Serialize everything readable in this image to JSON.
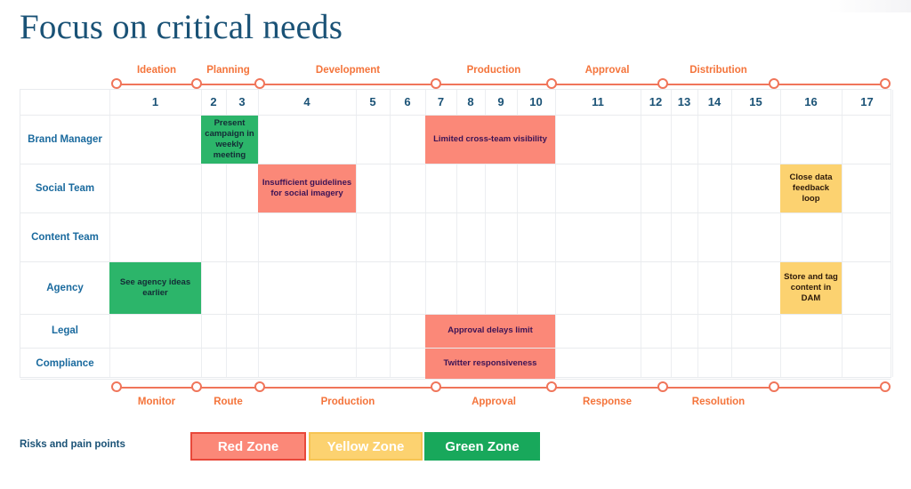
{
  "title": "Focus on critical needs",
  "colors": {
    "accent_orange": "#f0755a",
    "label_blue": "#1a5276",
    "red_zone": "#fb8878",
    "yellow_zone": "#fcd270",
    "green_zone": "#2cb56a"
  },
  "axis_top": {
    "labels": [
      "Ideation",
      "Planning",
      "Development",
      "Production",
      "Approval",
      "Distribution"
    ],
    "dots": 8
  },
  "axis_bottom": {
    "labels": [
      "Monitor",
      "Route",
      "Production",
      "Approval",
      "Response",
      "Resolution"
    ],
    "dots": 8
  },
  "grid": {
    "columns": [
      "1",
      "2",
      "3",
      "4",
      "5",
      "6",
      "7",
      "8",
      "9",
      "10",
      "11",
      "12",
      "13",
      "14",
      "15",
      "16",
      "17"
    ],
    "rows": [
      "Brand Manager",
      "Social Team",
      "Content Team",
      "Agency",
      "Legal",
      "Compliance"
    ]
  },
  "cells": [
    {
      "row": "Brand Manager",
      "cols": [
        "2",
        "3"
      ],
      "zone": "green",
      "text": "Present campaign in weekly meeting"
    },
    {
      "row": "Brand Manager",
      "cols": [
        "7",
        "8",
        "9",
        "10"
      ],
      "zone": "red",
      "text": "Limited cross-team visibility"
    },
    {
      "row": "Social Team",
      "cols": [
        "4"
      ],
      "zone": "red",
      "text": "Insufficient guidelines for social imagery"
    },
    {
      "row": "Social Team",
      "cols": [
        "16"
      ],
      "zone": "yellow",
      "text": "Close data feedback loop"
    },
    {
      "row": "Agency",
      "cols": [
        "1"
      ],
      "zone": "green",
      "text": "See agency ideas earlier"
    },
    {
      "row": "Agency",
      "cols": [
        "16"
      ],
      "zone": "yellow",
      "text": "Store and tag content in DAM"
    },
    {
      "row": "Legal",
      "cols": [
        "7",
        "8",
        "9",
        "10"
      ],
      "zone": "red",
      "text": "Approval delays limit"
    },
    {
      "row": "Compliance",
      "cols": [
        "7",
        "8",
        "9",
        "10"
      ],
      "zone": "red",
      "text": "Twitter responsiveness"
    }
  ],
  "legend": {
    "title": "Risks and pain points",
    "items": [
      {
        "label": "Red Zone",
        "zone": "red"
      },
      {
        "label": "Yellow Zone",
        "zone": "yellow"
      },
      {
        "label": "Green Zone",
        "zone": "green"
      }
    ]
  },
  "chart_data": {
    "type": "table",
    "title": "Focus on critical needs",
    "xlabel": "",
    "ylabel": "",
    "categories": [
      "1",
      "2",
      "3",
      "4",
      "5",
      "6",
      "7",
      "8",
      "9",
      "10",
      "11",
      "12",
      "13",
      "14",
      "15",
      "16",
      "17"
    ],
    "series": [
      {
        "name": "Brand Manager",
        "values": [
          "",
          "green",
          "green",
          "",
          "",
          "",
          "red",
          "red",
          "red",
          "red",
          "",
          "",
          "",
          "",
          "",
          "",
          ""
        ]
      },
      {
        "name": "Social Team",
        "values": [
          "",
          "",
          "",
          "red",
          "",
          "",
          "",
          "",
          "",
          "",
          "",
          "",
          "",
          "",
          "",
          "yellow",
          ""
        ]
      },
      {
        "name": "Content Team",
        "values": [
          "",
          "",
          "",
          "",
          "",
          "",
          "",
          "",
          "",
          "",
          "",
          "",
          "",
          "",
          "",
          "",
          ""
        ]
      },
      {
        "name": "Agency",
        "values": [
          "green",
          "",
          "",
          "",
          "",
          "",
          "",
          "",
          "",
          "",
          "",
          "",
          "",
          "",
          "",
          "yellow",
          ""
        ]
      },
      {
        "name": "Legal",
        "values": [
          "",
          "",
          "",
          "",
          "",
          "",
          "red",
          "red",
          "red",
          "red",
          "",
          "",
          "",
          "",
          "",
          "",
          ""
        ]
      },
      {
        "name": "Compliance",
        "values": [
          "",
          "",
          "",
          "",
          "",
          "",
          "red",
          "red",
          "red",
          "red",
          "",
          "",
          "",
          "",
          "",
          "",
          ""
        ]
      }
    ],
    "legend_position": "bottom-left",
    "grid": true
  }
}
